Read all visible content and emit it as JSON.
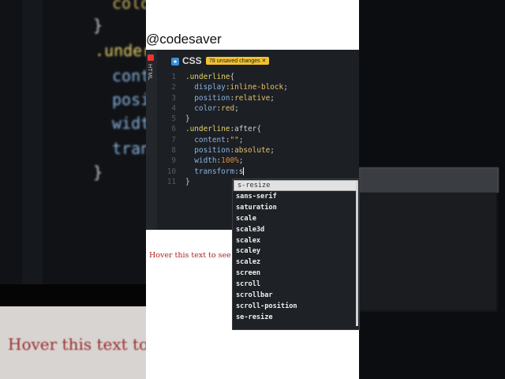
{
  "watermark": "@codesaver",
  "editor": {
    "side_tab": "HTML",
    "tab_icon": "css-file-icon",
    "tab_label": "CSS",
    "unsaved": "78 unsaved changes ✕",
    "lines": [
      {
        "n": "1",
        "parts": [
          {
            "t": ".underline",
            "c": "sel"
          },
          {
            "t": "{",
            "c": "punc"
          }
        ]
      },
      {
        "n": "2",
        "parts": [
          {
            "t": "  display",
            "c": "prop"
          },
          {
            "t": ":",
            "c": "punc"
          },
          {
            "t": "inline-block",
            "c": "val"
          },
          {
            "t": ";",
            "c": "punc"
          }
        ]
      },
      {
        "n": "3",
        "parts": [
          {
            "t": "  position",
            "c": "prop"
          },
          {
            "t": ":",
            "c": "punc"
          },
          {
            "t": "relative",
            "c": "val"
          },
          {
            "t": ";",
            "c": "punc"
          }
        ]
      },
      {
        "n": "4",
        "parts": [
          {
            "t": "  color",
            "c": "prop"
          },
          {
            "t": ":",
            "c": "punc"
          },
          {
            "t": "red",
            "c": "val"
          },
          {
            "t": ";",
            "c": "punc"
          }
        ]
      },
      {
        "n": "5",
        "parts": [
          {
            "t": "}",
            "c": "punc"
          }
        ]
      },
      {
        "n": "6",
        "parts": [
          {
            "t": ".underline",
            "c": "sel"
          },
          {
            "t": ":after{",
            "c": "punc"
          }
        ]
      },
      {
        "n": "7",
        "parts": [
          {
            "t": "  content",
            "c": "prop"
          },
          {
            "t": ":",
            "c": "punc"
          },
          {
            "t": "\"\"",
            "c": "val"
          },
          {
            "t": ";",
            "c": "punc"
          }
        ]
      },
      {
        "n": "8",
        "parts": [
          {
            "t": "  position",
            "c": "prop"
          },
          {
            "t": ":",
            "c": "punc"
          },
          {
            "t": "absolute",
            "c": "val"
          },
          {
            "t": ";",
            "c": "punc"
          }
        ]
      },
      {
        "n": "9",
        "parts": [
          {
            "t": "  width",
            "c": "prop"
          },
          {
            "t": ":",
            "c": "punc"
          },
          {
            "t": "100%",
            "c": "num-v"
          },
          {
            "t": ";",
            "c": "punc"
          }
        ]
      },
      {
        "n": "10",
        "parts": [
          {
            "t": "  transform",
            "c": "prop"
          },
          {
            "t": ":",
            "c": "punc"
          },
          {
            "t": "s",
            "c": "punc"
          }
        ],
        "cursor": true
      },
      {
        "n": "11",
        "parts": [
          {
            "t": "}",
            "c": "punc"
          }
        ]
      }
    ]
  },
  "preview_text": "Hover this text to see the",
  "bg_preview_text": "Hover this text to",
  "bg_code": [
    {
      "t": "color",
      "c": "#c9b45a"
    },
    {
      "t": "}",
      "c": "#cfcfcf"
    },
    {
      "t": ".under",
      "c": "#e6d36a"
    },
    {
      "t": "cont",
      "c": "#8ab4e0"
    },
    {
      "t": "posi",
      "c": "#8ab4e0"
    },
    {
      "t": "widt",
      "c": "#8ab4e0"
    },
    {
      "t": "tran",
      "c": "#8ab4e0"
    },
    {
      "t": "}",
      "c": "#cfcfcf"
    }
  ],
  "autocomplete": [
    "s-resize",
    "sans-serif",
    "saturation",
    "scale",
    "scale3d",
    "scalex",
    "scaley",
    "scalez",
    "screen",
    "scroll",
    "scrollbar",
    "scroll-position",
    "se-resize"
  ]
}
